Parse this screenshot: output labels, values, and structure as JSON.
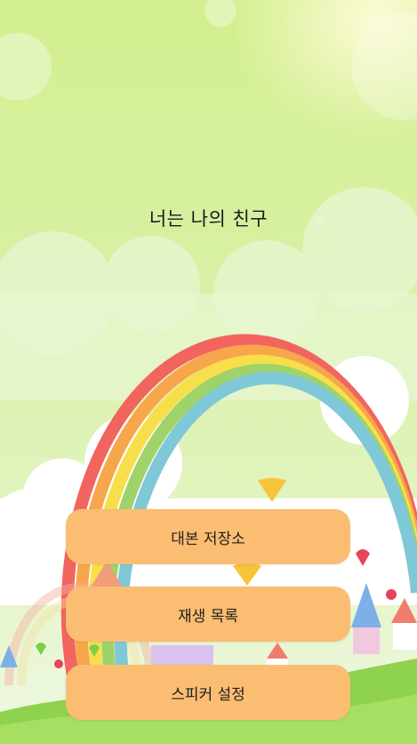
{
  "main": {
    "title": "너는 나의 친구"
  },
  "menu": {
    "buttons": [
      {
        "label": "대본 저장소"
      },
      {
        "label": "재생 목록"
      },
      {
        "label": "스피커 설정"
      }
    ]
  },
  "colors": {
    "sky_top": "#d6f0a0",
    "sky_bottom": "#eaf7d8",
    "button_bg": "#fbbd72",
    "grass": "#8fd24e"
  }
}
